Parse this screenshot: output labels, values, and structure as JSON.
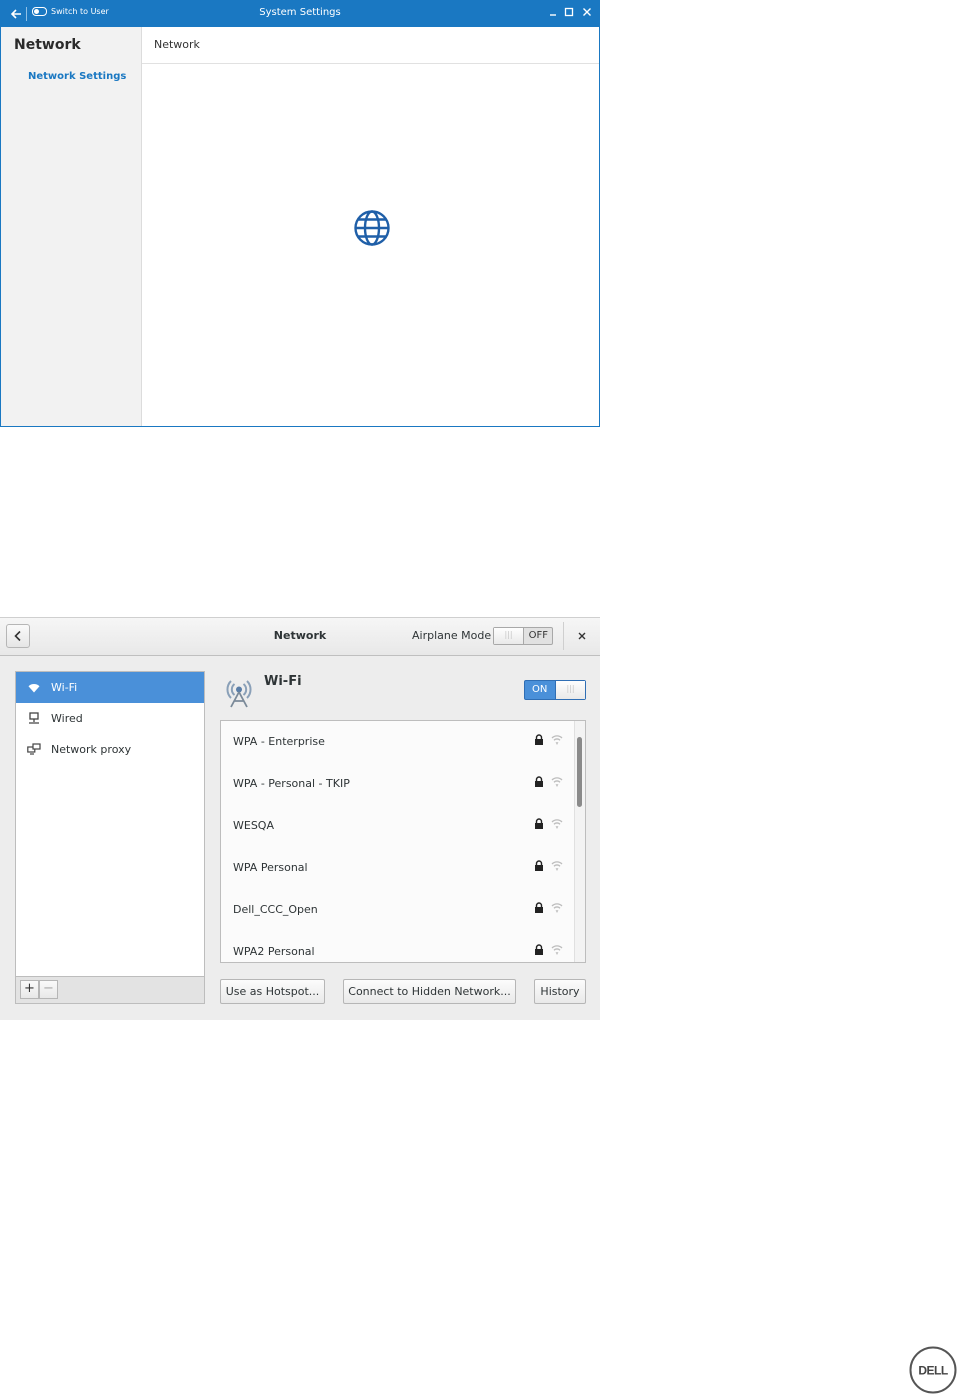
{
  "settings_window": {
    "switch_label": "Switch to User",
    "title": "System Settings",
    "sidebar_title": "Network",
    "sidebar_item": "Network Settings",
    "content_header": "Network",
    "accent": "#1a78c2"
  },
  "network_window": {
    "title": "Network",
    "airplane_mode_label": "Airplane Mode",
    "airplane_mode_state": "OFF",
    "sidebar": {
      "items": [
        {
          "label": "Wi-Fi",
          "icon": "wifi-icon",
          "selected": true
        },
        {
          "label": "Wired",
          "icon": "wired-icon",
          "selected": false
        },
        {
          "label": "Network proxy",
          "icon": "network-proxy-icon",
          "selected": false
        }
      ],
      "add_label": "+",
      "remove_label": "−"
    },
    "wifi": {
      "title": "Wi-Fi",
      "switch_state": "ON",
      "networks": [
        {
          "name": "WPA - Enterprise",
          "secured": true
        },
        {
          "name": "WPA - Personal - TKIP",
          "secured": true
        },
        {
          "name": "WESQA",
          "secured": true
        },
        {
          "name": "WPA Personal",
          "secured": true
        },
        {
          "name": "Dell_CCC_Open",
          "secured": true
        },
        {
          "name": "WPA2 Personal",
          "secured": true
        }
      ]
    },
    "buttons": {
      "hotspot": "Use as Hotspot...",
      "hidden": "Connect to Hidden Network...",
      "history": "History"
    },
    "accent": "#4a90d9"
  },
  "logo": {
    "text": "DELL"
  }
}
